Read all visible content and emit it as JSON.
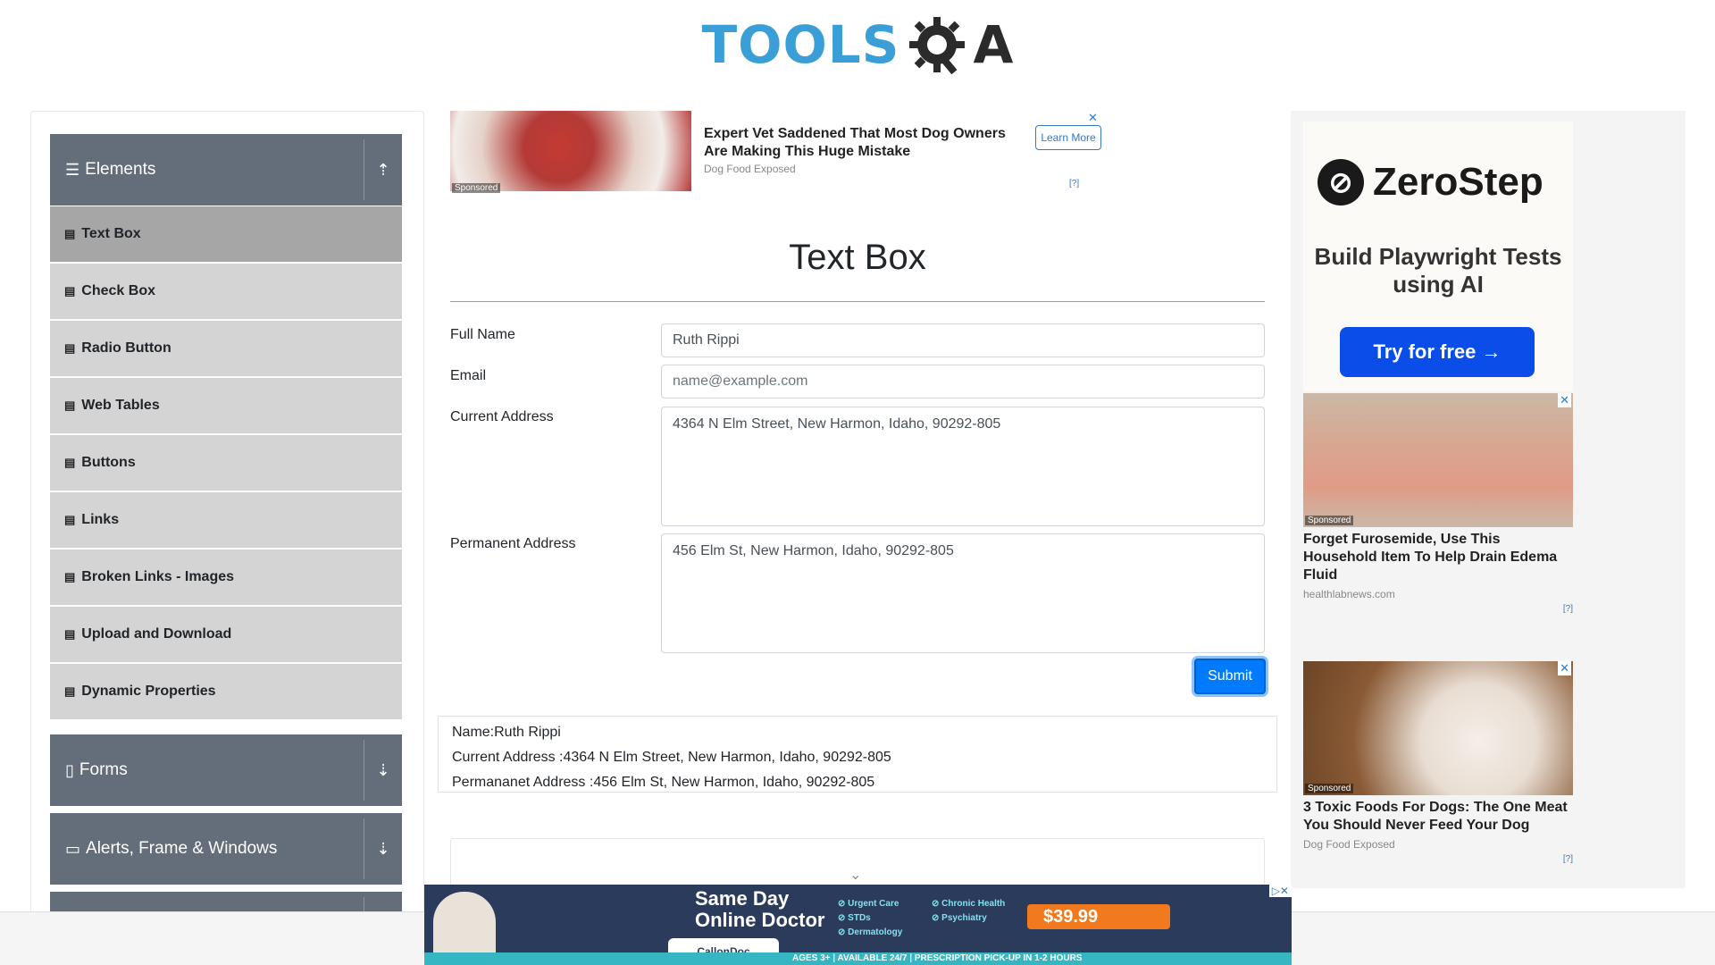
{
  "header": {
    "logo_left": "TOOLS",
    "logo_right": "A"
  },
  "sidebar": {
    "groups": [
      {
        "title": "Elements",
        "icon": "hamburger-icon",
        "arrow": "arrow-up-icon"
      },
      {
        "title": "Forms",
        "icon": "form-icon",
        "arrow": "arrow-down-icon"
      },
      {
        "title": "Alerts, Frame & Windows",
        "icon": "window-icon",
        "arrow": "arrow-down-icon"
      }
    ],
    "items": [
      "Text Box",
      "Check Box",
      "Radio Button",
      "Web Tables",
      "Buttons",
      "Links",
      "Broken Links - Images",
      "Upload and Download",
      "Dynamic Properties"
    ],
    "active_item": "Text Box"
  },
  "top_ad": {
    "title": "Expert Vet Saddened That Most Dog Owners Are Making This Huge Mistake",
    "source": "Dog Food Exposed",
    "button": "Learn More",
    "sponsored": "Sponsored",
    "close": "✕",
    "info": "[?]"
  },
  "main": {
    "title": "Text Box",
    "fields": {
      "full_name": {
        "label": "Full Name",
        "value": "Ruth Rippi"
      },
      "email": {
        "label": "Email",
        "placeholder": "name@example.com"
      },
      "current_address": {
        "label": "Current Address",
        "value": "4364 N Elm Street, New Harmon, Idaho, 90292-805"
      },
      "permanent_address": {
        "label": "Permanent Address",
        "value": "456 Elm St, New Harmon, Idaho, 90292-805"
      }
    },
    "submit": "Submit",
    "output": {
      "name": "Name:Ruth Rippi",
      "current": "Current Address :4364 N Elm Street, New Harmon, Idaho, 90292-805",
      "permanent": "Permananet Address :456 Elm St, New Harmon, Idaho, 90292-805"
    }
  },
  "right_ads": {
    "zerostep": {
      "brand": "ZeroStep",
      "tagline": "Build Playwright Tests using AI",
      "cta": "Try for free →"
    },
    "ad1": {
      "title": "Forget Furosemide, Use This Household Item To Help Drain Edema Fluid",
      "source": "healthlabnews.com",
      "sponsored": "Sponsored",
      "close": "✕",
      "info": "[?]"
    },
    "ad2": {
      "title": "3 Toxic Foods For Dogs: The One Meat You Should Never Feed Your Dog",
      "source": "Dog Food Exposed",
      "sponsored": "Sponsored",
      "close": "✕",
      "info": "[?]"
    }
  },
  "bottom_banner": {
    "headline_1": "Same Day",
    "headline_2": "Online Doctor",
    "checks_1": [
      "Urgent Care",
      "STDs",
      "Dermatology"
    ],
    "checks_2": [
      "Chronic Health",
      "Psychiatry"
    ],
    "price": "$39.99",
    "brand": "CallonDoc",
    "footer": "AGES 3+ | AVAILABLE 24/7 | PRESCRIPTION PICK-UP IN 1-2 HOURS"
  }
}
